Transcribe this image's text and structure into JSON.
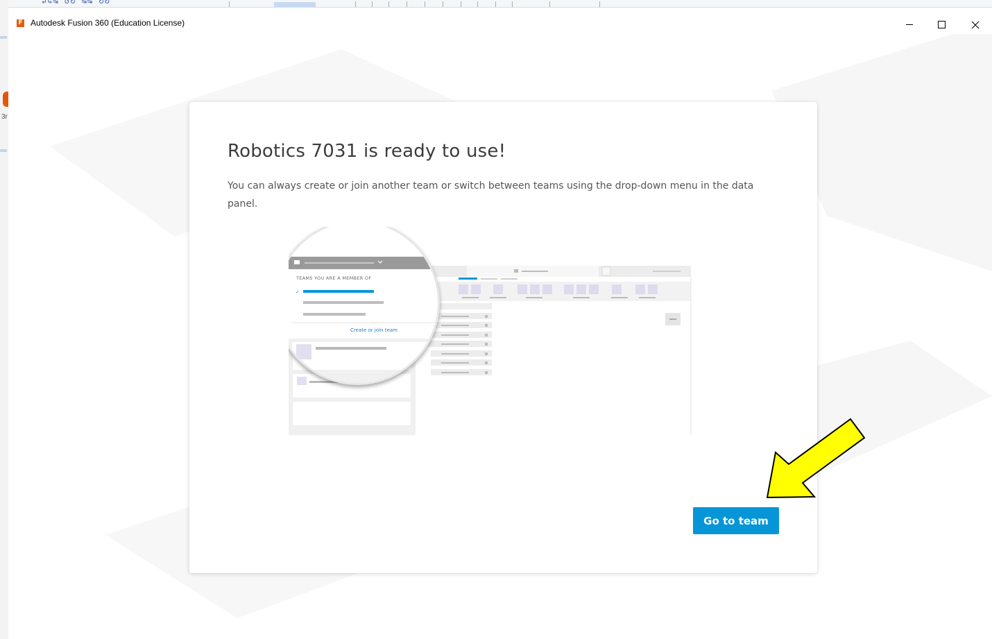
{
  "window": {
    "title": "Autodesk Fusion 360 (Education License)",
    "app_icon_letter": "F",
    "controls": [
      "minimize",
      "maximize",
      "close"
    ]
  },
  "dialog": {
    "heading": "Robotics 7031 is ready to use!",
    "description": "You can always create or join another team or switch between teams using the drop-down menu in the data panel.",
    "primary_button": "Go to team"
  },
  "illustration": {
    "menu_header": "TEAMS YOU ARE A MEMBER OF",
    "menu_link": "Create or join team"
  },
  "background_app": {
    "partial_label": "3r"
  },
  "colors": {
    "accent": "#0696d7",
    "app_icon": "#e8590c",
    "annotation_arrow": "#ffff00"
  }
}
